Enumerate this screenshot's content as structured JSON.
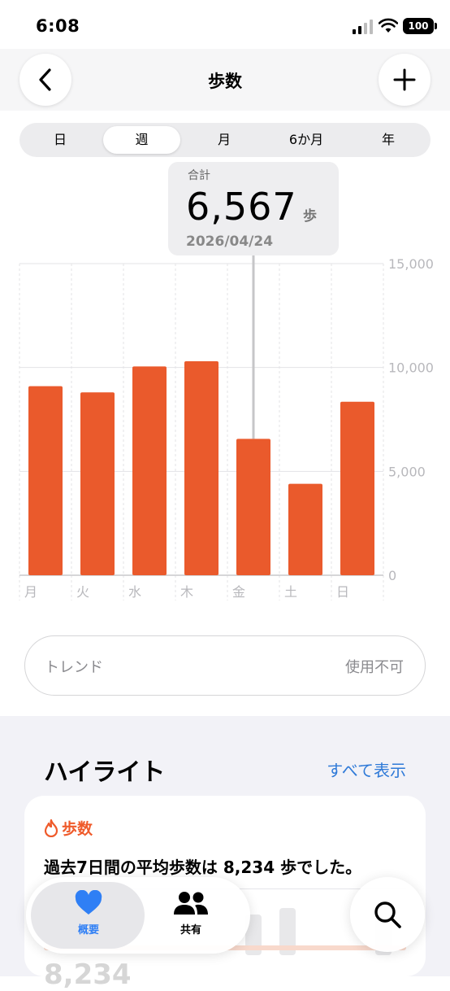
{
  "status": {
    "time": "6:08",
    "battery": "100"
  },
  "header": {
    "title": "歩数"
  },
  "segments": [
    "日",
    "週",
    "月",
    "6か月",
    "年"
  ],
  "selected_segment": "週",
  "tooltip": {
    "label": "合計",
    "value": "6,567",
    "unit": "歩",
    "date": "2026/04/24"
  },
  "chart_data": {
    "type": "bar",
    "categories": [
      "月",
      "火",
      "水",
      "木",
      "金",
      "土",
      "日"
    ],
    "values": [
      9100,
      8800,
      10050,
      10300,
      6567,
      4400,
      8350
    ],
    "ylim": [
      0,
      15000
    ],
    "yticks": [
      "15,000",
      "10,000",
      "5,000",
      "0"
    ],
    "highlight_index": 4,
    "bar_color": "#ea5a2c",
    "grid": true
  },
  "trend": {
    "label": "トレンド",
    "value": "使用不可"
  },
  "highlights": {
    "title": "ハイライト",
    "link": "すべて表示",
    "card": {
      "category": "歩数",
      "text": "過去7日間の平均歩数は 8,234 歩でした。",
      "number": "8,234"
    }
  },
  "tabbar": {
    "tabs": [
      {
        "label": "概要",
        "icon": "heart-icon"
      },
      {
        "label": "共有",
        "icon": "people-icon"
      }
    ]
  },
  "colors": {
    "accent": "#ea5a2c",
    "link": "#2f7ad8",
    "tab_active": "#2f7ff5"
  }
}
